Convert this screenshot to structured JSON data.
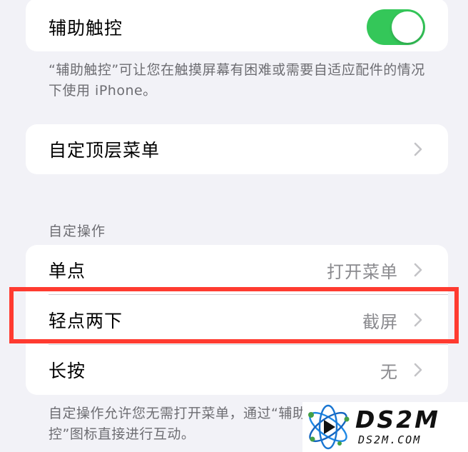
{
  "assistive_touch": {
    "label": "辅助触控",
    "toggle_on": true,
    "toggle_color": "#34c759",
    "footnote": "“辅助触控”可让您在触摸屏幕有困难或需要自适应配件的情况下使用 iPhone。"
  },
  "top_menu": {
    "label": "自定顶层菜单"
  },
  "custom_actions": {
    "header": "自定操作",
    "rows": [
      {
        "label": "单点",
        "value": "打开菜单"
      },
      {
        "label": "轻点两下",
        "value": "截屏"
      },
      {
        "label": "长按",
        "value": "无"
      }
    ],
    "footnote": "自定操作允许您无需打开菜单，通过“辅助触控”图标直接进行互动。"
  },
  "highlight_color": "#ff3b30",
  "watermark": {
    "brand": "DS2M",
    "domain": "DS2M.COM"
  }
}
